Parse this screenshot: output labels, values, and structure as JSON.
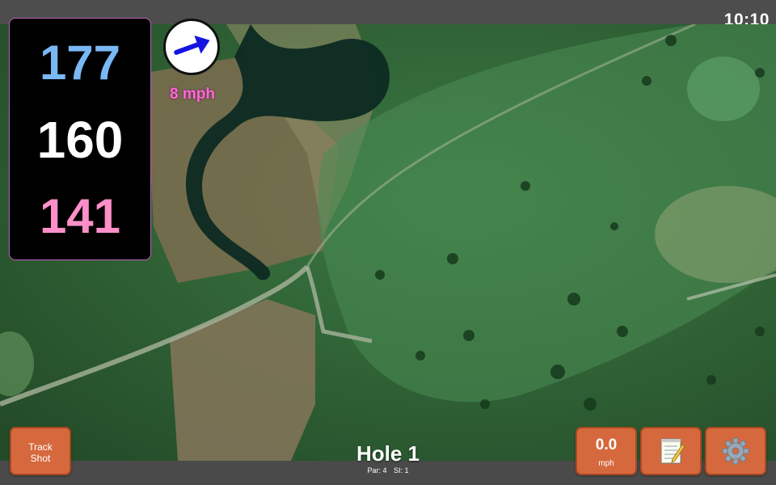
{
  "status": {
    "time": "10:10"
  },
  "yardage": {
    "back": "177",
    "center": "160",
    "front": "141",
    "colors": {
      "back": "#7ab8f5",
      "center": "#ffffff",
      "front": "#ff8fc8"
    }
  },
  "wind": {
    "speed_label": "8 mph",
    "direction_icon": "wind-arrow-icon",
    "arrow_color": "#1414e0"
  },
  "hole": {
    "title": "Hole 1",
    "par_label": "Par: 4",
    "si_label": "SI: 1"
  },
  "buttons": {
    "track_shot_line1": "Track",
    "track_shot_line2": "Shot",
    "wind_speed_value": "0.0",
    "wind_speed_unit": "mph",
    "notes_icon": "notepad-icon",
    "settings_icon": "gear-icon",
    "accent": "#d5693d"
  }
}
